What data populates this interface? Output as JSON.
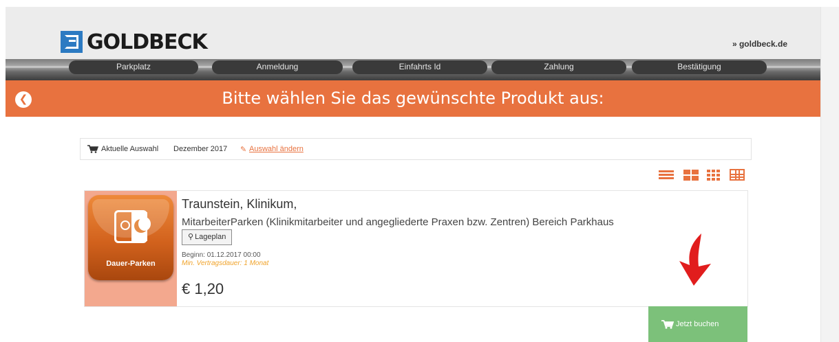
{
  "header": {
    "brand": "GOLDBECK",
    "link": "» goldbeck.de"
  },
  "steps": [
    "Parkplatz",
    "Anmeldung",
    "Einfahrts Id",
    "Zahlung",
    "Bestätigung"
  ],
  "banner": {
    "title": "Bitte wählen Sie das gewünschte Produkt aus:",
    "back_icon": "arrow-left-icon"
  },
  "selection": {
    "label": "Aktuelle Auswahl",
    "value": "Dezember 2017",
    "change_link": "Auswahl ändern"
  },
  "view_toggles": [
    "list-view-icon",
    "tiles-view-icon",
    "grid-view-icon",
    "table-view-icon"
  ],
  "product": {
    "icon_label": "Dauer-Parken",
    "title": "Traunstein, Klinikum,",
    "subtitle": "MitarbeiterParken (Klinikmitarbeiter und angegliederte Praxen bzw. Zentren) Bereich Parkhaus",
    "lageplan": "Lageplan",
    "beginn": "Beginn: 01.12.2017 00:00",
    "min_duration": "Min. Vertragsdauer: 1 Monat",
    "price": "€ 1,20"
  },
  "book_button": {
    "label": "Jetzt buchen"
  },
  "colors": {
    "accent": "#e8723f",
    "book_green": "#7cc17a",
    "warning_text": "#f0a32a",
    "header_bg": "#ececec",
    "arrow_red": "#e11d1d"
  }
}
